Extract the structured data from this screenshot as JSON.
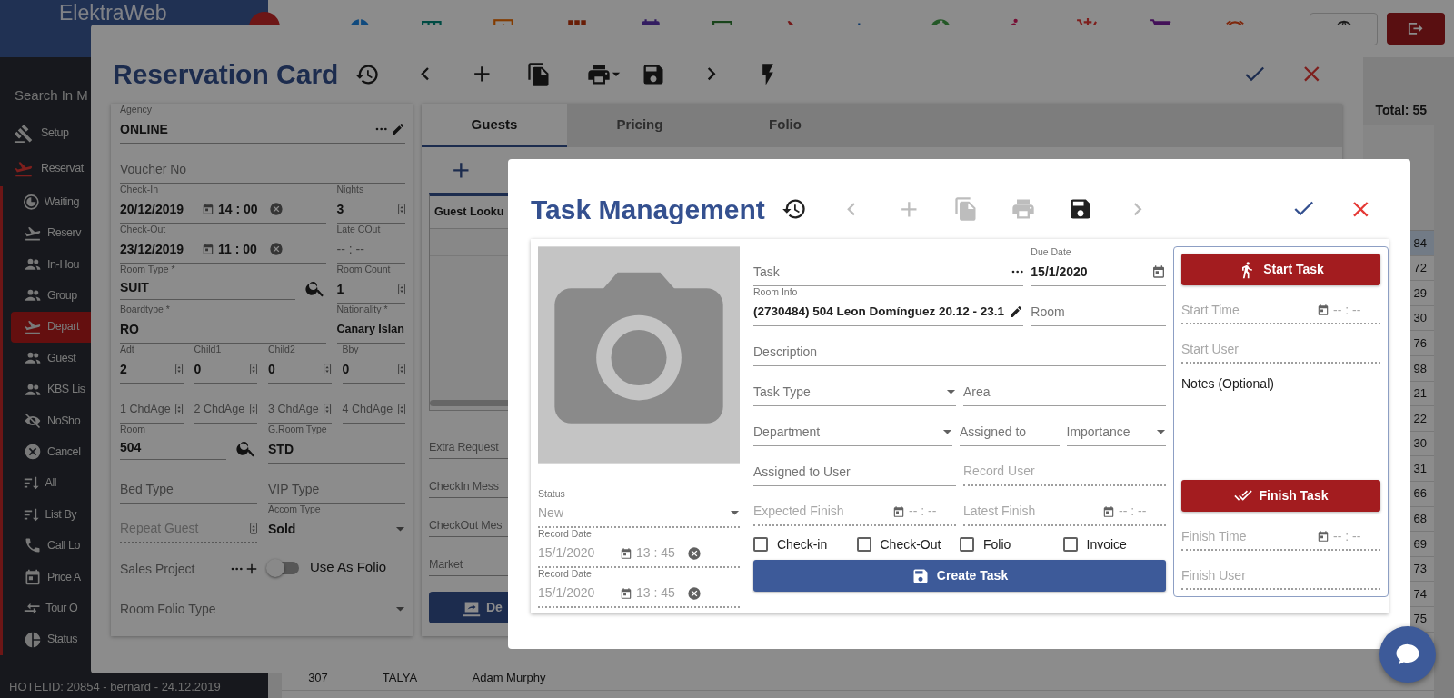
{
  "app": {
    "brand": "ElektraWeb",
    "search": {
      "placeholder": "Search In M"
    },
    "nav": [
      {
        "label": "Setup",
        "expanded": false
      },
      {
        "label": "Reservat",
        "expanded": true,
        "children": [
          {
            "label": "Waiting",
            "selected": false
          },
          {
            "label": "Reserv",
            "selected": false
          },
          {
            "label": "In-Hou",
            "selected": false
          },
          {
            "label": "Group",
            "selected": false
          },
          {
            "label": "Depart",
            "selected": true
          },
          {
            "label": "Guest",
            "selected": false
          },
          {
            "label": "KBS Lis",
            "selected": false
          },
          {
            "label": "NoSho",
            "selected": false
          },
          {
            "label": "Cancel",
            "selected": false
          },
          {
            "label": "All",
            "selected": false
          },
          {
            "label": "List By",
            "selected": false
          },
          {
            "label": "Call Lo",
            "selected": false
          },
          {
            "label": "Price A",
            "selected": false
          },
          {
            "label": "Tour O",
            "selected": false
          },
          {
            "label": "Status",
            "selected": false
          }
        ]
      }
    ],
    "footer": "HOTELID: 20854 - bernard - 24.12.2019",
    "total": "Total: 55",
    "rows": [
      {
        "last_column": "84",
        "selected": true
      },
      {
        "last_column": "72",
        "selected": false
      },
      {
        "last_column": "29",
        "selected": false
      },
      {
        "last_column": "30",
        "selected": false
      },
      {
        "last_column": "76",
        "selected": false
      },
      {
        "last_column": "98",
        "selected": false
      },
      {
        "last_column": "21",
        "selected": false
      },
      {
        "last_column": "22",
        "selected": false
      },
      {
        "last_column": "30",
        "selected": false
      },
      {
        "last_column": "31",
        "selected": false
      },
      {
        "last_column": "66",
        "selected": false
      },
      {
        "last_column": "68",
        "selected": false
      },
      {
        "last_column": "69",
        "selected": false
      },
      {
        "last_column": "73",
        "selected": false
      },
      {
        "last_column": "74",
        "selected": false
      },
      {
        "last_column": "75",
        "selected": false
      },
      {
        "column_1": "307",
        "column_2": "TALYA",
        "column_3": "Adam Murphy",
        "selected": false
      }
    ]
  },
  "reservation": {
    "title": "Reservation Card",
    "toolbar": [
      {
        "kind": "history",
        "disabled": false
      },
      {
        "kind": "previous",
        "disabled": false
      },
      {
        "kind": "add",
        "disabled": false
      },
      {
        "kind": "copy",
        "disabled": false
      },
      {
        "kind": "print_menu",
        "disabled": false
      },
      {
        "kind": "save",
        "disabled": false
      },
      {
        "kind": "next",
        "disabled": false
      },
      {
        "kind": "bolt",
        "disabled": false
      },
      {
        "kind": "confirm",
        "disabled": false
      },
      {
        "kind": "close",
        "disabled": false
      }
    ],
    "form": [
      [
        {
          "kind": "lookup_edit",
          "label": "Agency",
          "value": "ONLINE",
          "readonly": false
        }
      ],
      [
        {
          "kind": "text",
          "placeholder": "Voucher No",
          "readonly": false
        }
      ],
      [
        {
          "kind": "datetime",
          "label": "Check-In",
          "date": "20/12/2019",
          "time": "14 : 00",
          "readonly": false
        },
        {
          "kind": "spin",
          "label": "Nights",
          "value": "3",
          "readonly": false
        }
      ],
      [
        {
          "kind": "datetime",
          "label": "Check-Out",
          "date": "23/12/2019",
          "time": "11 : 00",
          "readonly": false
        },
        {
          "kind": "time",
          "label": "Late COut",
          "time_placeholder": "-- : --",
          "readonly": false
        }
      ],
      [
        {
          "kind": "search",
          "label": "Room Type *",
          "value": "SUIT",
          "readonly": false
        },
        {
          "kind": "spin",
          "label": "Room Count",
          "value": "1",
          "readonly": false
        }
      ],
      [
        {
          "kind": "text",
          "label": "Boardtype *",
          "value": "RO",
          "readonly": false
        },
        {
          "kind": "text",
          "label": "Nationality *",
          "value": "Canary Islan",
          "readonly": false
        }
      ],
      [
        {
          "kind": "spin",
          "label": "Adt",
          "value": "2",
          "readonly": false
        },
        {
          "kind": "spin",
          "label": "Child1",
          "value": "0",
          "readonly": false
        },
        {
          "kind": "spin",
          "label": "Child2",
          "value": "0",
          "readonly": false
        },
        {
          "kind": "spin",
          "label": "Bby",
          "value": "0",
          "readonly": false
        }
      ],
      [
        {
          "kind": "spin",
          "placeholder": "1 ChdAge",
          "readonly": false
        },
        {
          "kind": "spin",
          "placeholder": "2 ChdAge",
          "readonly": false
        },
        {
          "kind": "spin",
          "placeholder": "3 ChdAge",
          "readonly": false
        },
        {
          "kind": "spin",
          "placeholder": "4 ChdAge",
          "readonly": false
        }
      ],
      [
        {
          "kind": "search",
          "label": "Room",
          "value": "504",
          "readonly": false
        },
        {
          "kind": "text",
          "label": "G.Room Type",
          "value": "STD",
          "readonly": false
        }
      ],
      [
        {
          "kind": "text",
          "placeholder": "Bed Type",
          "readonly": false
        },
        {
          "kind": "text",
          "placeholder": "VIP Type",
          "readonly": false
        }
      ],
      [
        {
          "kind": "spin",
          "placeholder": "Repeat Guest",
          "readonly": true
        },
        {
          "kind": "select",
          "label": "Accom Type",
          "value": "Sold",
          "readonly": false
        }
      ],
      [
        {
          "kind": "lookup_add",
          "placeholder": "Sales Project",
          "readonly": false
        },
        {
          "kind": "toggle",
          "text": "Use As Folio",
          "on": false
        }
      ],
      [
        {
          "kind": "select",
          "placeholder": "Room Folio Type",
          "readonly": false
        }
      ]
    ],
    "tabs": [
      {
        "label": "Guests",
        "selected": true
      },
      {
        "label": "Pricing",
        "selected": false
      },
      {
        "label": "Folio",
        "selected": false
      }
    ],
    "guest_table": {
      "column_header": "Guest Looku"
    },
    "fields": [
      {
        "placeholder": "Extra Request"
      },
      {
        "placeholder": "CheckIn Mess"
      },
      {
        "placeholder": "CheckOut Mes"
      },
      {
        "placeholder": "Market"
      }
    ],
    "action_button": {
      "label": "De"
    }
  },
  "task": {
    "title": "Task Management",
    "toolbar": [
      {
        "kind": "history",
        "disabled": false
      },
      {
        "kind": "previous",
        "disabled": true
      },
      {
        "kind": "add",
        "disabled": true
      },
      {
        "kind": "copy",
        "disabled": true
      },
      {
        "kind": "print",
        "disabled": true
      },
      {
        "kind": "save",
        "disabled": false
      },
      {
        "kind": "next",
        "disabled": true
      },
      {
        "kind": "confirm",
        "disabled": false
      },
      {
        "kind": "close",
        "disabled": false
      }
    ],
    "side_fields": [
      {
        "kind": "select",
        "label": "Status",
        "value": "New",
        "readonly": true
      },
      {
        "kind": "datetime",
        "label": "Record Date",
        "date": "15/1/2020",
        "time": "13 : 45",
        "readonly": true
      },
      {
        "kind": "datetime",
        "label": "Record Date",
        "date": "15/1/2020",
        "time": "13 : 45",
        "readonly": true
      }
    ],
    "fields": [
      [
        {
          "kind": "lookup",
          "placeholder": "Task",
          "readonly": false
        },
        {
          "kind": "date",
          "label": "Due Date",
          "value": "15/1/2020",
          "readonly": false
        }
      ],
      [
        {
          "kind": "edit",
          "label": "Room Info",
          "value": "(2730484) 504 Leon Domínguez 20.12 - 23.1",
          "readonly": false
        },
        {
          "kind": "text",
          "placeholder": "Room",
          "readonly": false
        }
      ],
      [
        {
          "kind": "text",
          "placeholder": "Description",
          "readonly": false
        }
      ],
      [
        {
          "kind": "select",
          "placeholder": "Task Type",
          "readonly": false
        },
        {
          "kind": "text",
          "placeholder": "Area",
          "readonly": false
        }
      ],
      [
        {
          "kind": "select",
          "placeholder": "Department",
          "readonly": false
        },
        {
          "kind": "text",
          "placeholder": "Assigned to",
          "readonly": false
        },
        {
          "kind": "select",
          "placeholder": "Importance",
          "readonly": false
        }
      ],
      [
        {
          "kind": "text",
          "placeholder": "Assigned to User",
          "readonly": false
        },
        {
          "kind": "text",
          "placeholder": "Record User",
          "readonly": true
        }
      ],
      [
        {
          "kind": "timestamp",
          "placeholder": "Expected Finish",
          "time_placeholder": "-- : --",
          "readonly": true
        },
        {
          "kind": "timestamp",
          "placeholder": "Latest Finish",
          "time_placeholder": "-- : --",
          "readonly": true
        }
      ]
    ],
    "checkboxes": [
      {
        "label": "Check-in",
        "checked": false
      },
      {
        "label": "Check-Out",
        "checked": false
      },
      {
        "label": "Folio",
        "checked": false
      },
      {
        "label": "Invoice",
        "checked": false
      }
    ],
    "create_button": {
      "label": "Create Task"
    },
    "start_button": {
      "label": "Start Task"
    },
    "start_fields": [
      {
        "kind": "timestamp",
        "placeholder": "Start Time",
        "time_placeholder": "-- : --",
        "readonly": true
      },
      {
        "kind": "text",
        "placeholder": "Start User",
        "readonly": true
      }
    ],
    "notes": {
      "placeholder": "Notes (Optional)"
    },
    "finish_button": {
      "label": "Finish Task"
    },
    "finish_fields": [
      {
        "kind": "timestamp",
        "placeholder": "Finish Time",
        "time_placeholder": "-- : --",
        "readonly": true
      },
      {
        "kind": "text",
        "placeholder": "Finish User",
        "readonly": true
      }
    ]
  }
}
